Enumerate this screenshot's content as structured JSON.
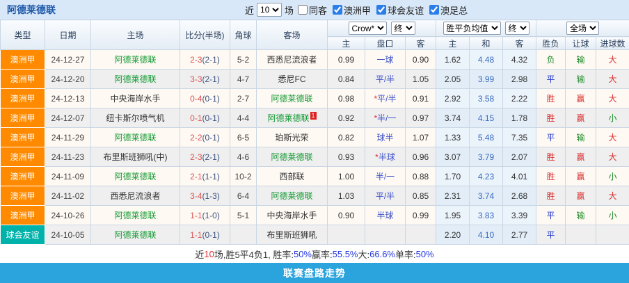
{
  "topbar": {
    "team_title": "阿德莱德联",
    "near_label": "近",
    "count_value": "10",
    "unit_label": "场",
    "same_away_label": "同客",
    "league_filters": [
      "澳洲甲",
      "球会友谊",
      "澳足总"
    ]
  },
  "table": {
    "headers": {
      "type": "类型",
      "date": "日期",
      "home": "主场",
      "score": "比分(半场)",
      "corner": "角球",
      "away": "客场",
      "odds_company": "Crow*",
      "odds_final": "终",
      "odds_home": "主",
      "odds_handicap": "盘口",
      "odds_away": "客",
      "mean_select": "胜平负均值",
      "mean_final": "终",
      "mean_home": "主",
      "mean_draw": "和",
      "mean_away": "客",
      "fulltime_select": "全场",
      "result": "胜负",
      "handicap_result": "让球",
      "goals": "进球数"
    },
    "rows": [
      {
        "type": "澳洲甲",
        "type_color": "orange",
        "date": "24-12-27",
        "home": "阿德莱德联",
        "home_highlight": true,
        "score_ft": "2-3",
        "score_ht": "(2-1)",
        "corner": "5-2",
        "away": "西悉尼流浪者",
        "away_highlight": false,
        "away_badge": "",
        "odds_home": "0.99",
        "handicap": "一球",
        "handicap_star": false,
        "odds_away": "0.90",
        "mean_home": "1.62",
        "mean_draw": "4.48",
        "mean_away": "4.32",
        "result": "负",
        "result_color": "green",
        "handicap_result": "输",
        "handicap_result_color": "green",
        "goals": "大",
        "goals_color": "red"
      },
      {
        "type": "澳洲甲",
        "type_color": "orange",
        "date": "24-12-20",
        "home": "阿德莱德联",
        "home_highlight": true,
        "score_ft": "3-3",
        "score_ht": "(2-1)",
        "corner": "4-7",
        "away": "悉尼FC",
        "away_highlight": false,
        "away_badge": "",
        "odds_home": "0.84",
        "handicap": "平/半",
        "handicap_star": false,
        "odds_away": "1.05",
        "mean_home": "2.05",
        "mean_draw": "3.99",
        "mean_away": "2.98",
        "result": "平",
        "result_color": "blue",
        "handicap_result": "输",
        "handicap_result_color": "green",
        "goals": "大",
        "goals_color": "red"
      },
      {
        "type": "澳洲甲",
        "type_color": "orange",
        "date": "24-12-13",
        "home": "中央海岸水手",
        "home_highlight": false,
        "score_ft": "0-4",
        "score_ht": "(0-1)",
        "corner": "2-7",
        "away": "阿德莱德联",
        "away_highlight": true,
        "away_badge": "",
        "odds_home": "0.98",
        "handicap": "平/半",
        "handicap_star": true,
        "odds_away": "0.91",
        "mean_home": "2.92",
        "mean_draw": "3.58",
        "mean_away": "2.22",
        "result": "胜",
        "result_color": "red",
        "handicap_result": "赢",
        "handicap_result_color": "red",
        "goals": "大",
        "goals_color": "red"
      },
      {
        "type": "澳洲甲",
        "type_color": "orange",
        "date": "24-12-07",
        "home": "纽卡斯尔喷气机",
        "home_highlight": false,
        "score_ft": "0-1",
        "score_ht": "(0-1)",
        "corner": "4-4",
        "away": "阿德莱德联",
        "away_highlight": true,
        "away_badge": "1",
        "odds_home": "0.92",
        "handicap": "半/一",
        "handicap_star": true,
        "odds_away": "0.97",
        "mean_home": "3.74",
        "mean_draw": "4.15",
        "mean_away": "1.78",
        "result": "胜",
        "result_color": "red",
        "handicap_result": "赢",
        "handicap_result_color": "red",
        "goals": "小",
        "goals_color": "green"
      },
      {
        "type": "澳洲甲",
        "type_color": "orange",
        "date": "24-11-29",
        "home": "阿德莱德联",
        "home_highlight": true,
        "score_ft": "2-2",
        "score_ht": "(0-1)",
        "corner": "6-5",
        "away": "珀斯光荣",
        "away_highlight": false,
        "away_badge": "",
        "odds_home": "0.82",
        "handicap": "球半",
        "handicap_star": false,
        "odds_away": "1.07",
        "mean_home": "1.33",
        "mean_draw": "5.48",
        "mean_away": "7.35",
        "result": "平",
        "result_color": "blue",
        "handicap_result": "输",
        "handicap_result_color": "green",
        "goals": "大",
        "goals_color": "red"
      },
      {
        "type": "澳洲甲",
        "type_color": "orange",
        "date": "24-11-23",
        "home": "布里斯班狮吼(中)",
        "home_highlight": false,
        "score_ft": "2-3",
        "score_ht": "(2-1)",
        "corner": "4-6",
        "away": "阿德莱德联",
        "away_highlight": true,
        "away_badge": "",
        "odds_home": "0.93",
        "handicap": "半球",
        "handicap_star": true,
        "odds_away": "0.96",
        "mean_home": "3.07",
        "mean_draw": "3.79",
        "mean_away": "2.07",
        "result": "胜",
        "result_color": "red",
        "handicap_result": "赢",
        "handicap_result_color": "red",
        "goals": "大",
        "goals_color": "red"
      },
      {
        "type": "澳洲甲",
        "type_color": "orange",
        "date": "24-11-09",
        "home": "阿德莱德联",
        "home_highlight": true,
        "score_ft": "2-1",
        "score_ht": "(1-1)",
        "corner": "10-2",
        "away": "西部联",
        "away_highlight": false,
        "away_badge": "",
        "odds_home": "1.00",
        "handicap": "半/一",
        "handicap_star": false,
        "odds_away": "0.88",
        "mean_home": "1.70",
        "mean_draw": "4.23",
        "mean_away": "4.01",
        "result": "胜",
        "result_color": "red",
        "handicap_result": "赢",
        "handicap_result_color": "red",
        "goals": "小",
        "goals_color": "green"
      },
      {
        "type": "澳洲甲",
        "type_color": "orange",
        "date": "24-11-02",
        "home": "西悉尼流浪者",
        "home_highlight": false,
        "score_ft": "3-4",
        "score_ht": "(1-3)",
        "corner": "6-4",
        "away": "阿德莱德联",
        "away_highlight": true,
        "away_badge": "",
        "odds_home": "1.03",
        "handicap": "平/半",
        "handicap_star": false,
        "odds_away": "0.85",
        "mean_home": "2.31",
        "mean_draw": "3.74",
        "mean_away": "2.68",
        "result": "胜",
        "result_color": "red",
        "handicap_result": "赢",
        "handicap_result_color": "red",
        "goals": "大",
        "goals_color": "red"
      },
      {
        "type": "澳洲甲",
        "type_color": "orange",
        "date": "24-10-26",
        "home": "阿德莱德联",
        "home_highlight": true,
        "score_ft": "1-1",
        "score_ht": "(1-0)",
        "corner": "5-1",
        "away": "中央海岸水手",
        "away_highlight": false,
        "away_badge": "",
        "odds_home": "0.90",
        "handicap": "半球",
        "handicap_star": false,
        "odds_away": "0.99",
        "mean_home": "1.95",
        "mean_draw": "3.83",
        "mean_away": "3.39",
        "result": "平",
        "result_color": "blue",
        "handicap_result": "输",
        "handicap_result_color": "green",
        "goals": "小",
        "goals_color": "green"
      },
      {
        "type": "球会友谊",
        "type_color": "teal",
        "date": "24-10-05",
        "home": "阿德莱德联",
        "home_highlight": true,
        "score_ft": "1-1",
        "score_ht": "(0-1)",
        "corner": "",
        "away": "布里斯班狮吼",
        "away_highlight": false,
        "away_badge": "",
        "odds_home": "",
        "handicap": "",
        "handicap_star": false,
        "odds_away": "",
        "mean_home": "2.20",
        "mean_draw": "4.10",
        "mean_away": "2.77",
        "result": "平",
        "result_color": "blue",
        "handicap_result": "",
        "handicap_result_color": "",
        "goals": "",
        "goals_color": ""
      }
    ]
  },
  "summary": {
    "segments": [
      {
        "text": "近",
        "color": "dark"
      },
      {
        "text": "10",
        "color": "red"
      },
      {
        "text": "场,胜5平4负1, 胜率:",
        "color": "dark"
      },
      {
        "text": "50%",
        "color": "blue"
      },
      {
        "text": " 赢率:",
        "color": "dark"
      },
      {
        "text": "55.5%",
        "color": "blue"
      },
      {
        "text": " 大:",
        "color": "dark"
      },
      {
        "text": "66.6%",
        "color": "blue"
      },
      {
        "text": " 单率:",
        "color": "dark"
      },
      {
        "text": "50%",
        "color": "blue"
      }
    ]
  },
  "footer": {
    "title": "联赛盘路走势"
  }
}
